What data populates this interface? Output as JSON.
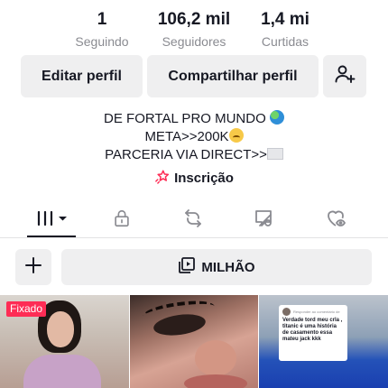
{
  "stats": {
    "following": {
      "value": "1",
      "label": "Seguindo"
    },
    "followers": {
      "value": "106,2 mil",
      "label": "Seguidores"
    },
    "likes": {
      "value": "1,4 mi",
      "label": "Curtidas"
    }
  },
  "actions": {
    "edit_label": "Editar perfil",
    "share_label": "Compartilhar perfil",
    "add_friend_icon": "add-user-icon"
  },
  "bio": {
    "line1": "DE FORTAL PRO MUNDO",
    "line2": "META>>200K",
    "line3": "PARCERIA VIA DIRECT>>"
  },
  "subscription": {
    "label": "Inscrição",
    "accent": "#fe2c55"
  },
  "tabs": [
    {
      "name": "videos",
      "icon": "grid-bars-icon",
      "active": true
    },
    {
      "name": "private",
      "icon": "lock-icon"
    },
    {
      "name": "reposts",
      "icon": "repost-icon"
    },
    {
      "name": "tagged",
      "icon": "tagged-eye-icon"
    },
    {
      "name": "liked",
      "icon": "liked-heart-eye-icon"
    }
  ],
  "playlist": {
    "label": "MILHÃO"
  },
  "grid": {
    "pinned_label": "Fixado",
    "reply_author": "Responder ao comentário de",
    "reply_text": "Verdade tord meu crla , titanic é uma história de casamento essa mateu jack kkk"
  },
  "colors": {
    "text": "#161823",
    "secondary": "#8a8b91",
    "button_bg": "#efeff0",
    "pinned_bg": "#fe2c55"
  }
}
